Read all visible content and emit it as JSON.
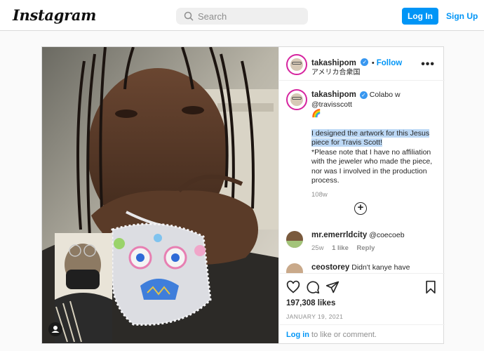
{
  "nav": {
    "logo": "Instagram",
    "search_placeholder": "Search",
    "login_label": "Log In",
    "signup_label": "Sign Up"
  },
  "post": {
    "username": "takashipom",
    "follow_label": "Follow",
    "location": "アメリカ合衆国",
    "caption": {
      "username": "takashipom",
      "line1": "Colabo w",
      "mention": "@travisscott",
      "emoji": "🌈",
      "highlighted": "I designed the artwork for this Jesus piece for Travis Scott!",
      "body": "*Please note that I have no affiliation with the jeweler who made the piece, nor was I involved in the production process.",
      "age": "108w"
    },
    "comments": [
      {
        "username": "mr.emerrldcity",
        "text": "@coecoeb",
        "age": "25w",
        "likes": "1 like",
        "reply": "Reply"
      },
      {
        "username": "ceostorey",
        "text": "Didn't kanye have"
      }
    ],
    "likes": "197,308 likes",
    "date": "JANUARY 19, 2021",
    "login_prompt": {
      "link": "Log in",
      "rest": " to like or comment."
    }
  },
  "icons": {
    "search": "search-icon",
    "more": "more-options-icon",
    "heart": "heart-icon",
    "comment": "comment-icon",
    "share": "share-icon",
    "bookmark": "bookmark-icon",
    "add_comment": "plus-circle-icon",
    "user_tag": "user-tag-icon"
  },
  "colors": {
    "accent": "#0095f6",
    "verified": "#3897f0",
    "highlight": "#bcd8f5"
  }
}
